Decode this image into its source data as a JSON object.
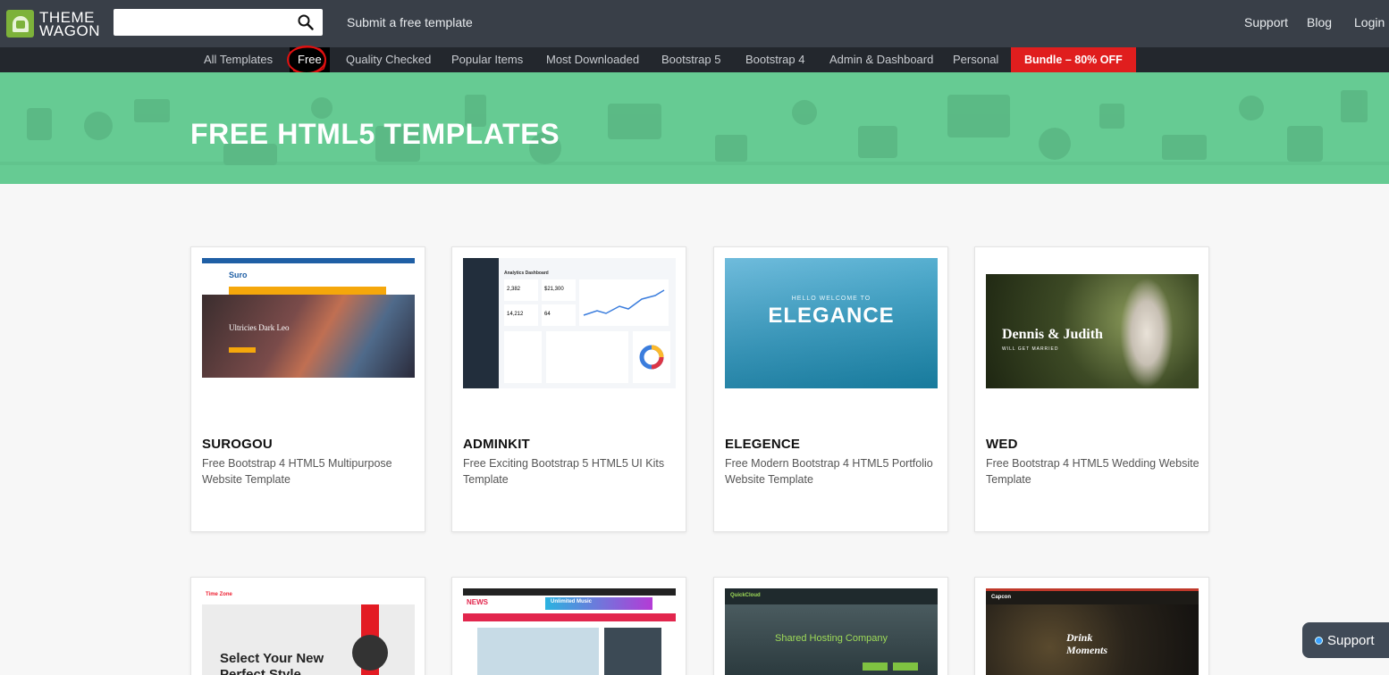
{
  "header": {
    "logo_line1": "THEME",
    "logo_line2": "WAGON",
    "search_placeholder": "",
    "submit_link": "Submit a free template",
    "links": [
      "Support",
      "Blog",
      "Login"
    ]
  },
  "nav": {
    "items": [
      "All Templates",
      "Free",
      "Quality Checked",
      "Popular Items",
      "Most Downloaded",
      "Bootstrap 5",
      "Bootstrap 4",
      "Admin & Dashboard",
      "Personal"
    ],
    "active": "Free",
    "bundle": "Bundle – 80% OFF"
  },
  "banner": {
    "title": "FREE HTML5 TEMPLATES"
  },
  "cards": [
    {
      "title": "SUROGOU",
      "desc": "Free Bootstrap 4 HTML5 Multipurpose Website Template",
      "thumb_heading": "Ultricies Dark Leo",
      "thumb_logo": "Suro"
    },
    {
      "title": "ADMINKIT",
      "desc": "Free Exciting Bootstrap 5 HTML5 UI Kits Template",
      "thumb_heading": "Analytics Dashboard",
      "thumb_stats": [
        "2,382",
        "$21,300",
        "14,212",
        "64"
      ]
    },
    {
      "title": "ELEGENCE",
      "desc": "Free Modern Bootstrap 4 HTML5 Portfolio Website Template",
      "thumb_heading": "ELEGANCE",
      "thumb_sub": "HELLO WELCOME TO"
    },
    {
      "title": "WED",
      "desc": "Free Bootstrap 4 HTML5 Wedding Website Template",
      "thumb_heading": "Dennis & Judith",
      "thumb_sub": "WILL GET MARRIED"
    },
    {
      "title": "",
      "desc": "",
      "thumb_heading": "Select Your New Perfect Style",
      "thumb_logo": "Time Zone"
    },
    {
      "title": "",
      "desc": "",
      "thumb_heading": "Unlimited Music",
      "thumb_logo": "NEWS"
    },
    {
      "title": "",
      "desc": "",
      "thumb_heading": "Shared Hosting Company",
      "thumb_logo": "QuickCloud"
    },
    {
      "title": "",
      "desc": "",
      "thumb_heading": "Drink Moments",
      "thumb_logo": "Capcon"
    }
  ],
  "support_widget": {
    "label": "Support"
  },
  "colors": {
    "topbar": "#393f48",
    "navbar": "#23272d",
    "banner": "#66cb93",
    "bundle": "#e01e1e",
    "brand": "#7db23a"
  }
}
